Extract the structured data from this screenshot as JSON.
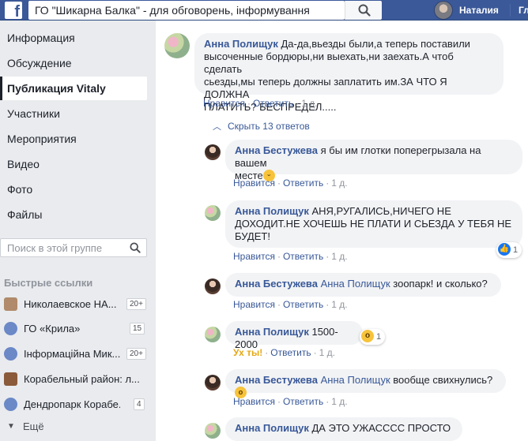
{
  "topbar": {
    "logo": "f",
    "search_value": "ГО \"Шикарна Балка\" - для обговорень, інформування гро...",
    "user_name": "Наталия",
    "home_label": "Гл"
  },
  "sidebar": {
    "nav": [
      "Информация",
      "Обсуждение",
      "Публикация Vitaly",
      "Участники",
      "Мероприятия",
      "Видео",
      "Фото",
      "Файлы"
    ],
    "search_placeholder": "Поиск в этой группе",
    "quick_links_title": "Быстрые ссылки",
    "quick_links": [
      {
        "label": "Николаевское НА...",
        "count": "20+"
      },
      {
        "label": "ГО «Крила»",
        "count": "15"
      },
      {
        "label": "Інформаційна Мик...",
        "count": "20+"
      },
      {
        "label": "Корабельный район: л...",
        "count": ""
      },
      {
        "label": "Дендропарк Корабе...",
        "count": "4"
      }
    ],
    "more_label": "Ещё"
  },
  "comments": {
    "c1": {
      "author": "Анна Полищук",
      "text1": " Да-да,вьезды были,а теперь поставили",
      "text2": "высоченные бордюры,ни выехать,ни заехать.А чтоб сделать",
      "text3": "сьезды,мы теперь должны заплатить им.ЗА ЧТО Я ДОЛЖНА",
      "text4": "ПЛАТИТЬ? БЕСПРЕДЕЛ.....",
      "like": "Нравится",
      "reply": "Ответить",
      "time": "1 д."
    },
    "hide_replies": "Скрыть 13 ответов",
    "r1": {
      "author": "Анна Бестужева",
      "text1": " я бы им глотки поперегрызала на вашем",
      "text2": "месте",
      "like": "Нравится",
      "reply": "Ответить",
      "time": "1 д."
    },
    "r2": {
      "author": "Анна Полищук",
      "text1": " АНЯ,РУГАЛИСЬ,НИЧЕГО НЕ",
      "text2": "ДОХОДИТ.НЕ ХОЧЕШЬ НЕ ПЛАТИ И СЬЕЗДА У ТЕБЯ НЕ",
      "text3": "БУДЕТ!",
      "like": "Нравится",
      "reply": "Ответить",
      "time": "1 д.",
      "reactions": "1"
    },
    "r3": {
      "author": "Анна Бестужева",
      "mention": "Анна Полищук",
      "text": " зоопарк!   и сколько?",
      "like": "Нравится",
      "reply": "Ответить",
      "time": "1 д."
    },
    "r4": {
      "author": "Анна Полищук",
      "text": " 1500-2000",
      "reaction_label": "Ух ты!",
      "reply": "Ответить",
      "time": "1 д.",
      "reactions": "1"
    },
    "r5": {
      "author": "Анна Бестужева",
      "mention": "Анна Полищук",
      "text": " вообще свихнулись?",
      "like": "Нравится",
      "reply": "Ответить",
      "time": "1 д."
    },
    "r6": {
      "author": "Анна Полищук",
      "text": " ДА ЭТО УЖАСССС ПРОСТО"
    }
  },
  "colors": {
    "brand_blue": "#3b5998",
    "link_blue": "#385898",
    "bubble_bg": "#f2f3f5",
    "page_bg": "#e9ebee"
  }
}
